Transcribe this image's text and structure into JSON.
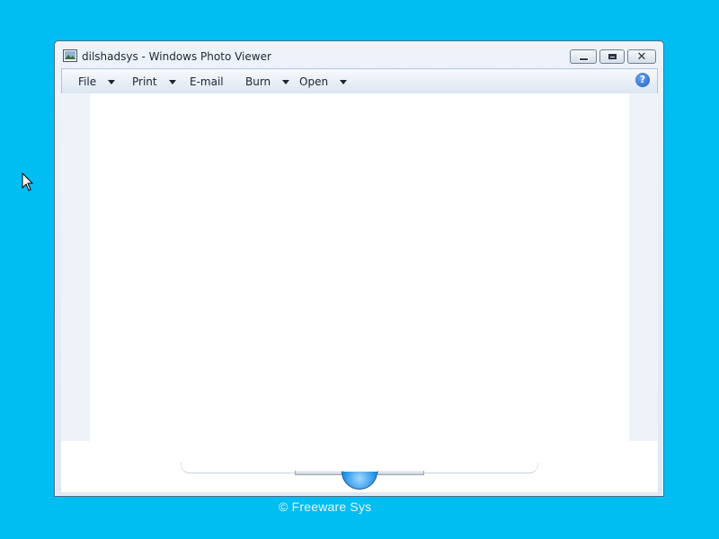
{
  "window": {
    "title": "dilshadsys - Windows Photo Viewer"
  },
  "menu": {
    "items": [
      {
        "label": "File",
        "has_dropdown": true
      },
      {
        "label": "Print",
        "has_dropdown": true
      },
      {
        "label": "E-mail",
        "has_dropdown": false
      },
      {
        "label": "Burn",
        "has_dropdown": true
      },
      {
        "label": "Open",
        "has_dropdown": true
      }
    ],
    "help_label": "?"
  },
  "icons": {
    "app": "photo-viewer-icon",
    "minimize": "minimize-icon",
    "maximize": "maximize-icon",
    "close": "close-icon",
    "help": "help-icon",
    "play": "slideshow-play-icon",
    "cursor": "mouse-cursor-icon"
  },
  "watermark": {
    "text": "©  Freeware Sys"
  },
  "colors": {
    "desktop": "#00bdf2",
    "help_button": "#1d5fc1",
    "play_button": "#1e8fe6"
  }
}
